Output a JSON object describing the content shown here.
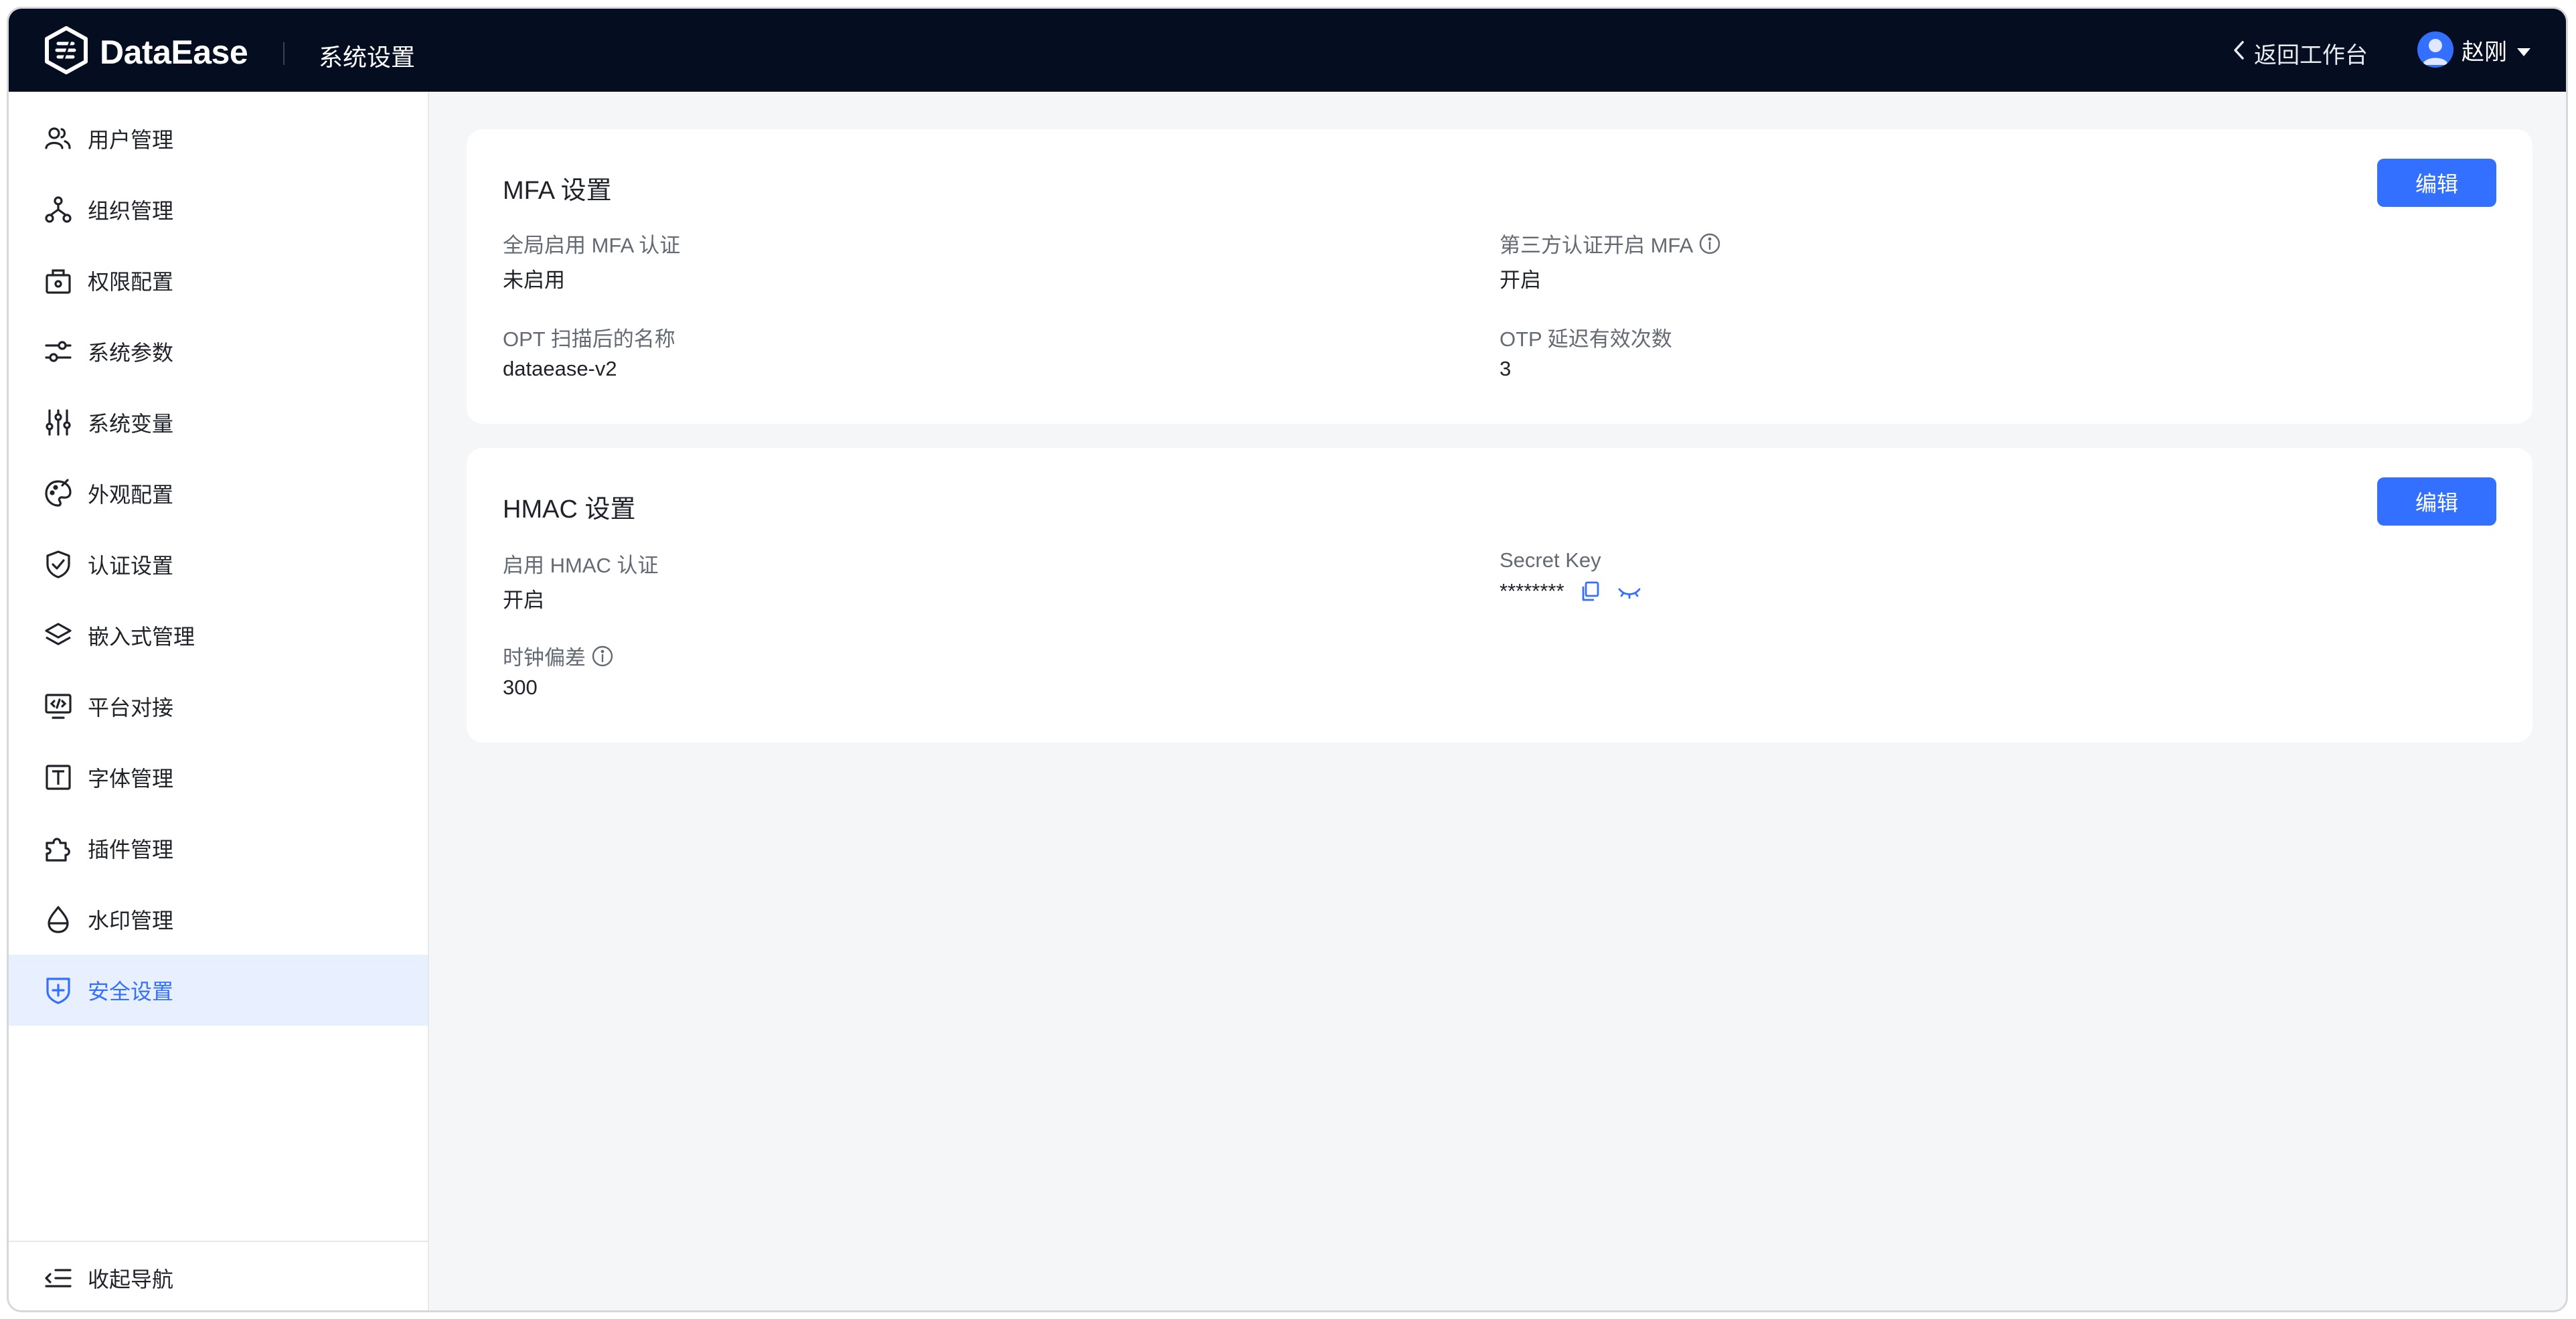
{
  "header": {
    "logo_text": "DataEase",
    "section_title": "系统设置",
    "back_label": "返回工作台",
    "user_name": "赵刚"
  },
  "sidebar": {
    "items": [
      {
        "label": "用户管理",
        "icon": "users-icon"
      },
      {
        "label": "组织管理",
        "icon": "org-icon"
      },
      {
        "label": "权限配置",
        "icon": "permission-icon"
      },
      {
        "label": "系统参数",
        "icon": "params-icon"
      },
      {
        "label": "系统变量",
        "icon": "variables-icon"
      },
      {
        "label": "外观配置",
        "icon": "palette-icon"
      },
      {
        "label": "认证设置",
        "icon": "shield-check-icon"
      },
      {
        "label": "嵌入式管理",
        "icon": "layers-icon"
      },
      {
        "label": "平台对接",
        "icon": "monitor-code-icon"
      },
      {
        "label": "字体管理",
        "icon": "font-icon"
      },
      {
        "label": "插件管理",
        "icon": "plugin-icon"
      },
      {
        "label": "水印管理",
        "icon": "drop-icon"
      },
      {
        "label": "安全设置",
        "icon": "shield-plus-icon",
        "active": true
      }
    ],
    "collapse_label": "收起导航"
  },
  "mfa": {
    "title": "MFA 设置",
    "edit_label": "编辑",
    "global_label": "全局启用 MFA 认证",
    "global_value": "未启用",
    "third_label": "第三方认证开启 MFA",
    "third_value": "开启",
    "opt_label": "OPT 扫描后的名称",
    "opt_value": "dataease-v2",
    "otp_label": "OTP 延迟有效次数",
    "otp_value": "3"
  },
  "hmac": {
    "title": "HMAC 设置",
    "edit_label": "编辑",
    "enable_label": "启用 HMAC 认证",
    "enable_value": "开启",
    "secret_label": "Secret Key",
    "secret_value": "********",
    "clock_label": "时钟偏差",
    "clock_value": "300"
  },
  "colors": {
    "primary": "#3370ff",
    "header_bg": "#050e21",
    "page_bg": "#f5f6f7",
    "active_bg": "#e8f0ff"
  }
}
